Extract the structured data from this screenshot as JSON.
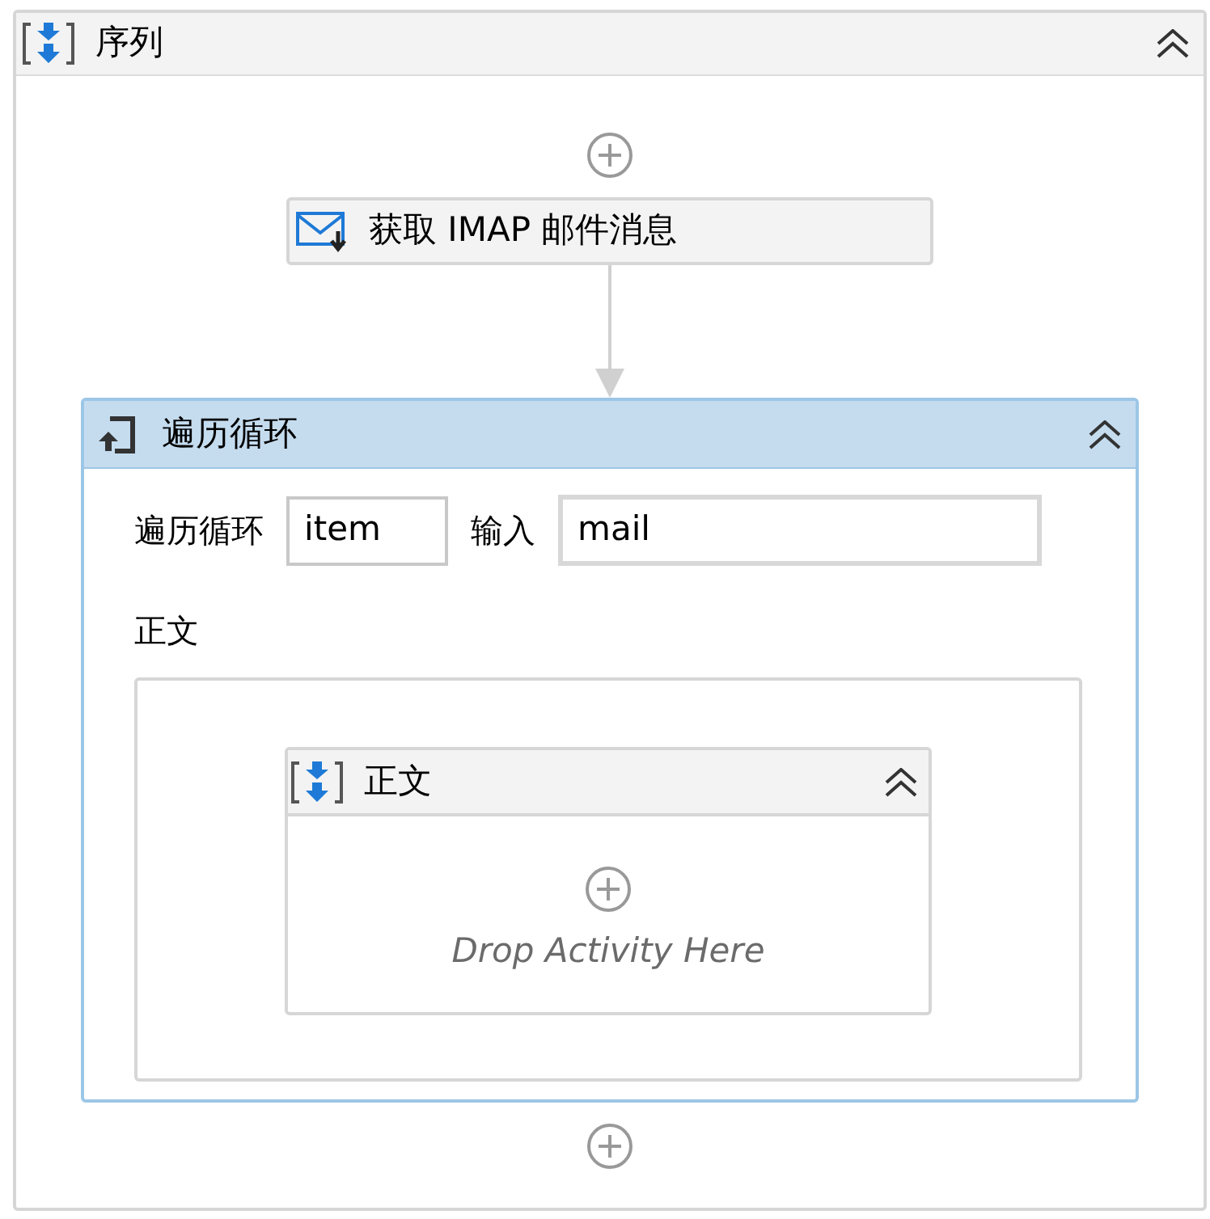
{
  "sequence": {
    "title": "序列",
    "activities": [
      {
        "kind": "activity",
        "title": "获取 IMAP 邮件消息"
      },
      {
        "kind": "foreach",
        "title": "遍历循环",
        "item_label": "遍历循环",
        "item_value": "item",
        "input_label": "输入",
        "input_value": "mail",
        "body_label": "正文",
        "body": {
          "title": "正文",
          "drop_hint": "Drop Activity Here"
        }
      }
    ]
  }
}
